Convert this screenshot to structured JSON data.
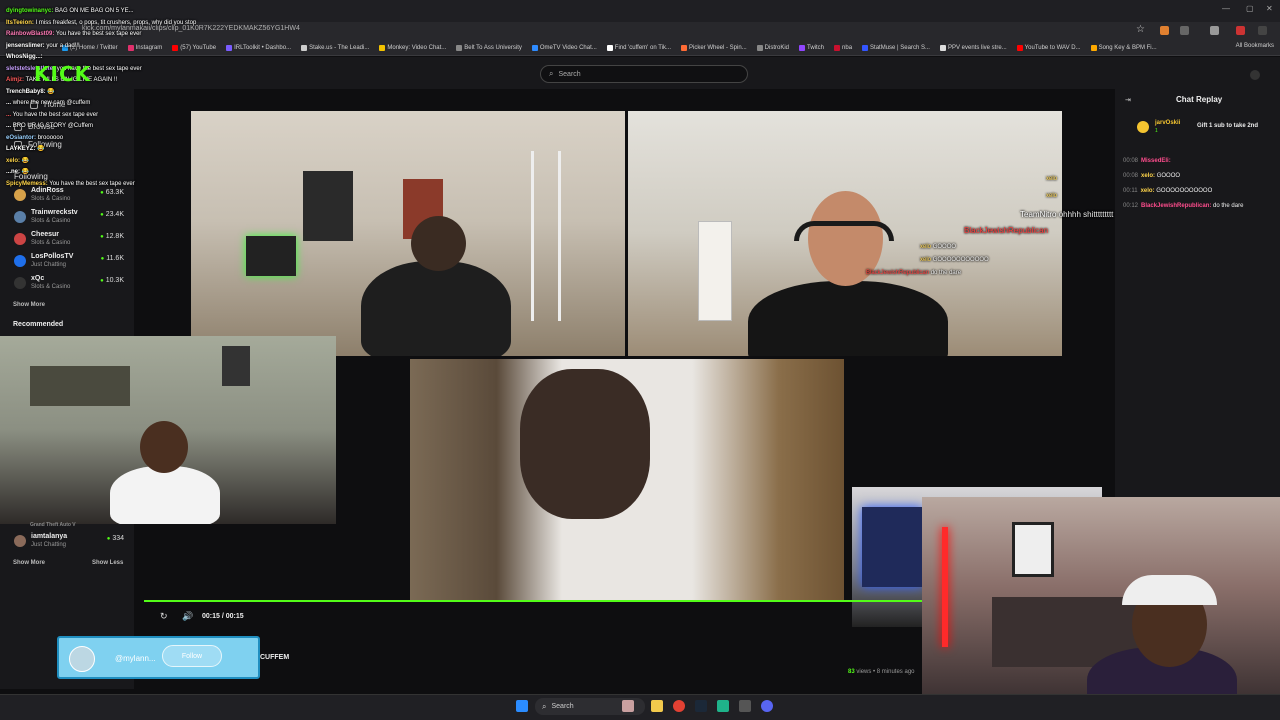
{
  "browser": {
    "url": "kick.com/mylanmakaii/clips/clip_01K0R7K222YEDKMAKZ56YG1HW4",
    "bookmarks": [
      {
        "label": "(2) Home / Twitter",
        "color": "#1d9bf0"
      },
      {
        "label": "Instagram",
        "color": "#e1306c"
      },
      {
        "label": "(57) YouTube",
        "color": "#ff0000"
      },
      {
        "label": "IRLToolkit • Dashbo...",
        "color": "#7a5cff"
      },
      {
        "label": "Stake.us - The Leadi...",
        "color": "#cccccc"
      },
      {
        "label": "Monkey: Video Chat...",
        "color": "#f2c200"
      },
      {
        "label": "Belt To Ass University",
        "color": "#888888"
      },
      {
        "label": "OmeTV Video Chat...",
        "color": "#2e8bff"
      },
      {
        "label": "Find 'cuffem' on Tik...",
        "color": "#ffffff"
      },
      {
        "label": "Picker Wheel - Spin...",
        "color": "#ff6b35"
      },
      {
        "label": "DistroKid",
        "color": "#888888"
      },
      {
        "label": "Twitch",
        "color": "#9146ff"
      },
      {
        "label": "nba",
        "color": "#c8102e"
      },
      {
        "label": "StatMuse | Search S...",
        "color": "#3355ff"
      },
      {
        "label": "PPV events live stre...",
        "color": "#dddddd"
      },
      {
        "label": "YouTube to WAV D...",
        "color": "#ff0000"
      },
      {
        "label": "Song Key & BPM Fi...",
        "color": "#ffaa00"
      }
    ],
    "all_bookmarks": "All Bookmarks"
  },
  "kick": {
    "logo": "KICK",
    "search_placeholder": "Search"
  },
  "sidebar": {
    "nav": [
      {
        "label": "Home",
        "icon": "home-icon"
      },
      {
        "label": "Browse",
        "icon": "browse-icon"
      },
      {
        "label": "Following",
        "icon": "following-icon"
      }
    ],
    "following_header": "Following",
    "channels": [
      {
        "name": "AdinRoss",
        "category": "Slots & Casino",
        "viewers": "63.3K",
        "color": "#d8a24a"
      },
      {
        "name": "Trainwreckstv",
        "category": "Slots & Casino",
        "viewers": "23.4K",
        "color": "#5a7fa8"
      },
      {
        "name": "Cheesur",
        "category": "Slots & Casino",
        "viewers": "12.8K",
        "color": "#c44"
      },
      {
        "name": "LosPollosTV",
        "category": "Just Chatting",
        "viewers": "11.6K",
        "color": "#1f6feb"
      },
      {
        "name": "xQc",
        "category": "Slots & Casino",
        "viewers": "10.3K",
        "color": "#333"
      }
    ],
    "show_more": "Show More",
    "recommended_header": "Recommended",
    "recommended_channel": {
      "name": "iamtalanya",
      "category": "Just Chatting",
      "viewers": "334",
      "partial": "Grand Theft Auto V"
    },
    "show_more_2": "Show More",
    "show_less": "Show Less"
  },
  "overlay_chat": [
    {
      "user": "dyingtowinanyc:",
      "msg": "BAG ON ME BAG ON 5 YE...",
      "color": "#53fc18"
    },
    {
      "user": "ItsTeeion:",
      "msg": "I miss freakfest, o pops, tit crushers, props, why did you stop",
      "color": "#ffd54a"
    },
    {
      "user": "RainbowBlast09:",
      "msg": "You have the best sex tape ever",
      "color": "#ff7ab6"
    },
    {
      "user": "jensenslimer:",
      "msg": "your a dad!!!",
      "color": "#ffffff"
    },
    {
      "user": "WhosNigg...:",
      "msg": "",
      "color": "#ffffff"
    },
    {
      "user": "sletstetsletstlete:",
      "msg": "you have the best sex tape ever",
      "color": "#c8a0ff"
    },
    {
      "user": "Aimjz:",
      "msg": "TAKE PILLS ON IG LIVE AGAIN !!",
      "color": "#ff5a5a"
    },
    {
      "user": "TrenchBaby8:",
      "msg": "😂",
      "color": "#ffffff"
    },
    {
      "user": "...",
      "msg": "where the new cam @cuffem",
      "color": "#ffffff"
    },
    {
      "user": "...",
      "msg": "You have the best sex tape ever",
      "color": "#ff5a5a"
    },
    {
      "user": "...",
      "msg": "BRO UR IG STORY @Cuffem",
      "color": "#ffffff"
    },
    {
      "user": "eOsiantor:",
      "msg": "broooooo",
      "color": "#9ad1ff"
    },
    {
      "user": "LAYKEYZ:",
      "msg": "😂",
      "color": "#ffffff"
    },
    {
      "user": "xelo:",
      "msg": "😂",
      "color": "#ffd54a"
    },
    {
      "user": "...ne:",
      "msg": "😂",
      "color": "#ffffff"
    },
    {
      "user": "SpicyMemess:",
      "msg": "You have the best sex tape ever",
      "color": "#ffd54a"
    }
  ],
  "cam_chat": [
    {
      "user": "xelo",
      "color": "#ffd54a"
    },
    {
      "user": "xelo",
      "color": "#ffd54a"
    },
    {
      "user": "TeamNitro",
      "msg": "ohhhh shittttttttt",
      "color": "#ffffff"
    },
    {
      "user": "BlackJewishRepublican",
      "color": "#ff3b3b"
    },
    {
      "user": "xelo",
      "msg": "GOOOO",
      "color": "#ffd54a"
    },
    {
      "user": "xelo",
      "msg": "GOOOOOOOOOOO",
      "color": "#ffd54a"
    },
    {
      "user": "BlackJewishRepublican",
      "msg": "do the dare",
      "color": "#ff3b3b"
    }
  ],
  "video": {
    "time": "00:15 / 00:15",
    "progress_percent": 100
  },
  "clip_card": {
    "handle": "@mylann...",
    "follow": "Follow",
    "channel": "CUFFEM",
    "views_count": "83",
    "views_suffix": "views • 8 minutes ago"
  },
  "chat_replay": {
    "title": "Chat Replay",
    "pinned": {
      "user": "jarvOskii",
      "count": "1",
      "msg": "Gift 1 sub to take 2nd"
    },
    "messages": [
      {
        "ts": "00:08",
        "user": "MissedEli:",
        "msg": "",
        "color": "#ff4d8d"
      },
      {
        "ts": "00:08",
        "user": "xelo:",
        "msg": "GOOOO",
        "color": "#ffd54a"
      },
      {
        "ts": "00:11",
        "user": "xelo:",
        "msg": "GOOOOOOOOOOO",
        "color": "#ffd54a"
      },
      {
        "ts": "00:12",
        "user": "BlackJewishRepublican:",
        "msg": "do the dare",
        "color": "#ff4d8d"
      }
    ]
  },
  "taskbar": {
    "search": "Search"
  },
  "colors": {
    "kick_green": "#53fc18",
    "follow_card": "#7fd1f0"
  }
}
